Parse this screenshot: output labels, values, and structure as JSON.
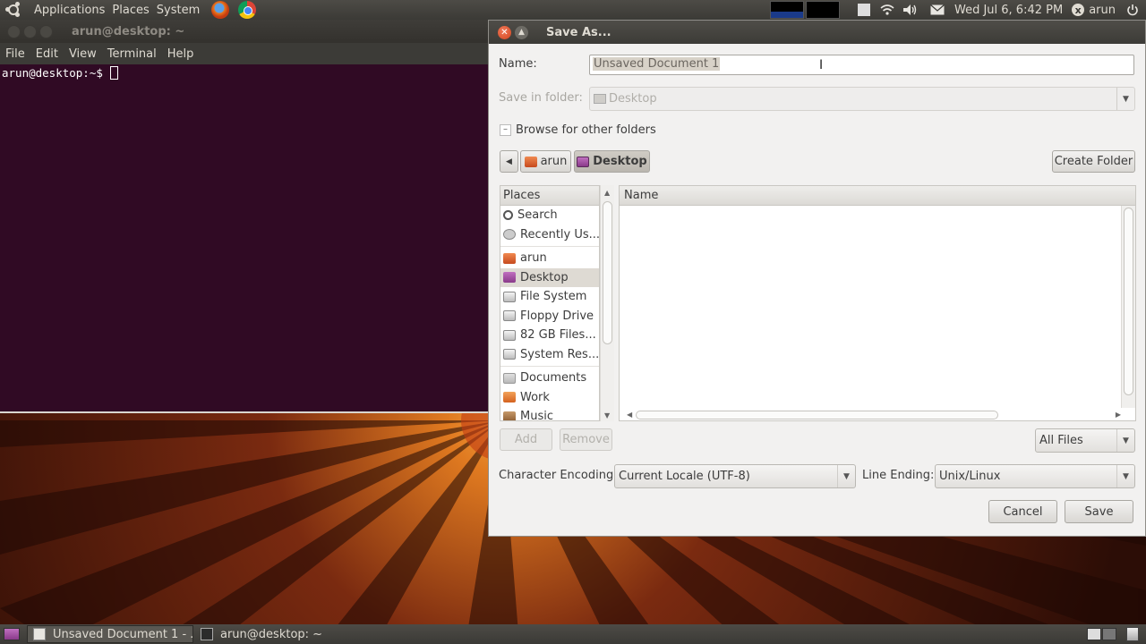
{
  "top_panel": {
    "menus": [
      "Applications",
      "Places",
      "System"
    ],
    "launchers": [
      "firefox-icon",
      "chrome-icon"
    ],
    "clock": "Wed Jul  6,  6:42 PM",
    "user": "arun"
  },
  "terminal": {
    "title": "arun@desktop: ~",
    "menus": [
      "File",
      "Edit",
      "View",
      "Terminal",
      "Help"
    ],
    "prompt": "arun@desktop:~$"
  },
  "dialog": {
    "title": "Save As...",
    "name_label": "Name:",
    "name_value": "Unsaved Document 1",
    "save_in_label": "Save in folder:",
    "save_in_value": "Desktop",
    "browse_label": "Browse for other folders",
    "breadcrumbs": [
      "arun",
      "Desktop"
    ],
    "create_folder": "Create Folder",
    "places_header": "Places",
    "places": [
      {
        "label": "Search",
        "icon": "search-icon"
      },
      {
        "label": "Recently Us...",
        "icon": "recent-icon"
      },
      {
        "label": "arun",
        "icon": "home-folder-icon"
      },
      {
        "label": "Desktop",
        "icon": "desktop-folder-icon",
        "selected": true
      },
      {
        "label": "File System",
        "icon": "drive-icon"
      },
      {
        "label": "Floppy Drive",
        "icon": "floppy-icon"
      },
      {
        "label": "82 GB Files...",
        "icon": "drive-icon"
      },
      {
        "label": "System Res...",
        "icon": "drive-icon"
      },
      {
        "label": "Documents",
        "icon": "documents-icon"
      },
      {
        "label": "Work",
        "icon": "folder-icon"
      },
      {
        "label": "Music",
        "icon": "music-icon"
      }
    ],
    "files_header": "Name",
    "add_label": "Add",
    "remove_label": "Remove",
    "filter_value": "All Files",
    "encoding_label": "Character Encoding:",
    "encoding_value": "Current Locale (UTF-8)",
    "line_ending_label": "Line Ending:",
    "line_ending_value": "Unix/Linux",
    "cancel_label": "Cancel",
    "save_label": "Save"
  },
  "taskbar": {
    "tasks": [
      {
        "label": "Unsaved Document 1 - ...",
        "active": true
      },
      {
        "label": "arun@desktop: ~",
        "active": false
      }
    ]
  }
}
